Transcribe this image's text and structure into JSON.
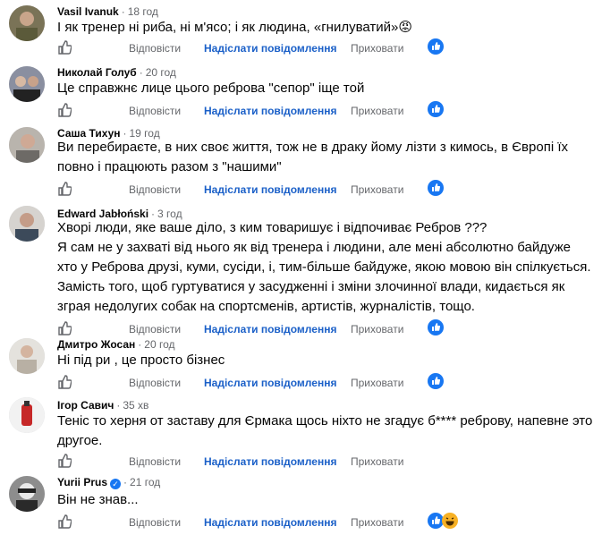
{
  "actions": {
    "reply": "Відповісти",
    "send_message": "Надіслати повідомлення",
    "hide": "Приховати"
  },
  "comments": [
    {
      "author": "Vasil Ivanuk",
      "time": "18 год",
      "lines": [
        "І як тренер ні риба, ні м'ясо; і як людина, «гнилуватий»😡"
      ],
      "reaction": "like-icon"
    },
    {
      "author": "Николай Голуб",
      "time": "20 год",
      "lines": [
        "Це справжнє лице цього реброва \"сепор\" іще той"
      ],
      "reaction": "like-icon"
    },
    {
      "author": "Саша Тихун",
      "time": "19 год",
      "lines": [
        "Ви перебираєте, в них своє життя, тож не в драку йому лізти з кимось, в Європі їх",
        "повно і працюють разом з \"нашими\""
      ],
      "reaction": "like-icon"
    },
    {
      "author": "Edward Jabłoński",
      "time": "3 год",
      "lines": [
        "Хворі люди, яке ваше діло, з ким товаришує і відпочиває Ребров ???",
        "Я сам не у захваті від нього як від тренера і людини, але мені абсолютно байдуже",
        "хто у Реброва друзі, куми, сусіди, і, тим-більше байдуже, якою мовою він спілкується.",
        "Замість того, щоб гуртуватися у засудженні і зміни злочинної влади, кидається як",
        "зграя недолугих собак на спортсменів, артистів, журналістів, тощо."
      ],
      "reaction": "like-icon"
    },
    {
      "author": "Дмитро Жосан",
      "time": "20 год",
      "lines": [
        "Ні під  ри , це просто бізнес"
      ],
      "reaction": "like-icon"
    },
    {
      "author": "Ігор Савич",
      "time": "35 хв",
      "lines": [
        "Теніс то херня от заставу для Єрмака щось ніхто не згадує б**** реброву, напевне это",
        "другое."
      ],
      "reaction": "like-icon"
    },
    {
      "author": "Yurii Prus",
      "time": "21 год",
      "lines": [
        "Він не знав..."
      ],
      "reaction": "like-haha-icons"
    }
  ],
  "colors": {
    "link": "#1b60c8",
    "muted": "#65676b",
    "like_blue": "#1877f2"
  }
}
